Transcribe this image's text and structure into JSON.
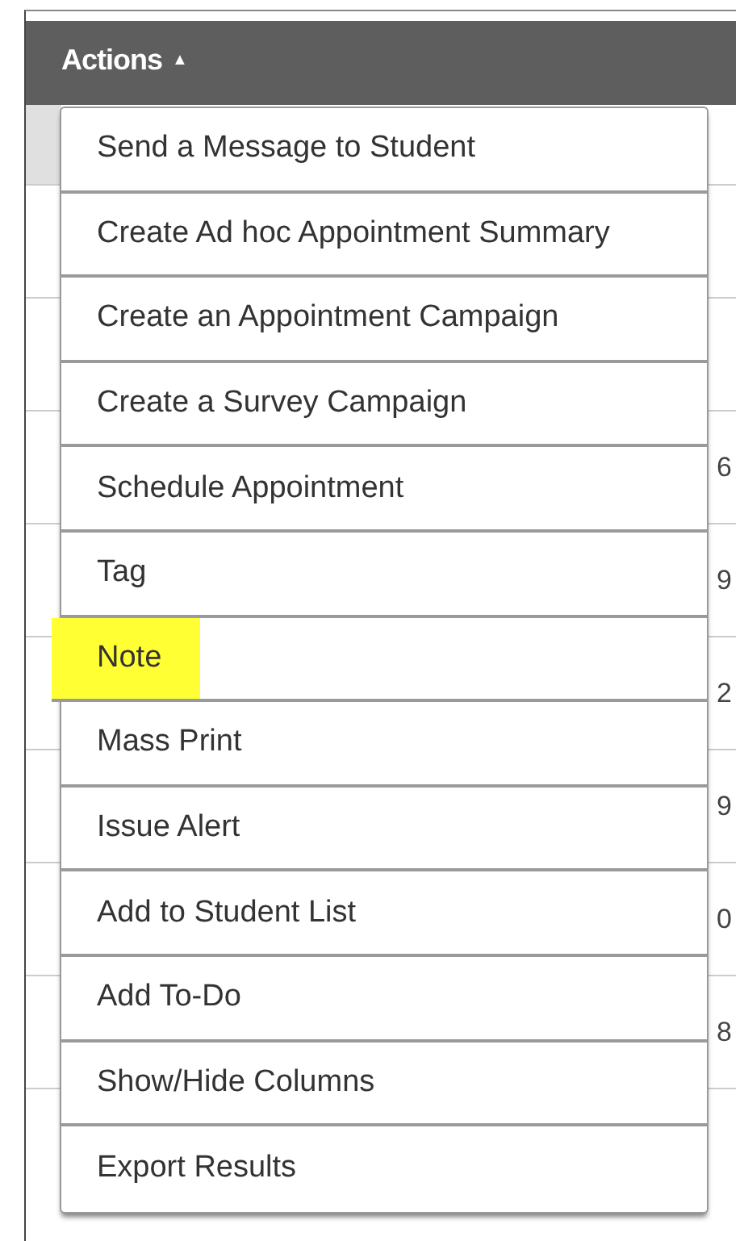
{
  "header": {
    "actions_button": {
      "label": "Actions",
      "caret": "▲",
      "expanded": true
    }
  },
  "table": {
    "rows": [
      {
        "column_end": ""
      },
      {
        "column_end": ""
      },
      {
        "column_end": ""
      },
      {
        "column_end": "6"
      },
      {
        "column_end": "9"
      },
      {
        "column_end": "2"
      },
      {
        "column_end": "9"
      },
      {
        "column_end": "0"
      },
      {
        "column_end": "8"
      }
    ]
  },
  "menu": {
    "items": [
      {
        "label": "Send a Message to Student",
        "highlighted": false
      },
      {
        "label": "Create Ad hoc Appointment Summary",
        "highlighted": false
      },
      {
        "label": "Create an Appointment Campaign",
        "highlighted": false
      },
      {
        "label": "Create a Survey Campaign",
        "highlighted": false
      },
      {
        "label": "Schedule Appointment",
        "highlighted": false
      },
      {
        "label": "Tag",
        "highlighted": false
      },
      {
        "label": "Note",
        "highlighted": true
      },
      {
        "label": "Mass Print",
        "highlighted": false
      },
      {
        "label": "Issue Alert",
        "highlighted": false
      },
      {
        "label": "Add to Student List",
        "highlighted": false
      },
      {
        "label": "Add To-Do",
        "highlighted": false
      },
      {
        "label": "Show/Hide Columns",
        "highlighted": false
      },
      {
        "label": "Export Results",
        "highlighted": false
      }
    ]
  }
}
